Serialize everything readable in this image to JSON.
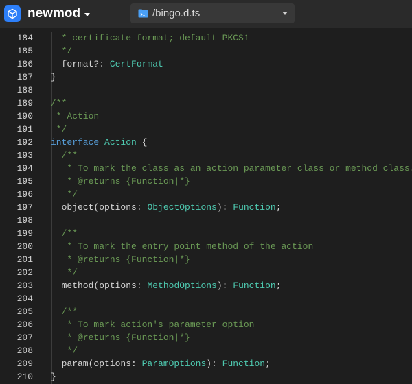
{
  "app": {
    "project_name": "newmod",
    "file_path": "/bingo.d.ts",
    "logo_icon": "cube-icon",
    "accent": "#2d7ff9"
  },
  "editor": {
    "lines": [
      {
        "no": "184",
        "segments": [
          {
            "t": "  * certificate format; default PKCS1",
            "c": "c"
          }
        ]
      },
      {
        "no": "185",
        "segments": [
          {
            "t": "  */",
            "c": "c"
          }
        ]
      },
      {
        "no": "186",
        "segments": [
          {
            "t": "  format?: ",
            "c": "p"
          },
          {
            "t": "CertFormat",
            "c": "t"
          }
        ]
      },
      {
        "no": "187",
        "segments": [
          {
            "t": "}",
            "c": "p"
          }
        ]
      },
      {
        "no": "188",
        "segments": []
      },
      {
        "no": "189",
        "segments": [
          {
            "t": "/**",
            "c": "c"
          }
        ]
      },
      {
        "no": "190",
        "segments": [
          {
            "t": " * Action",
            "c": "c"
          }
        ]
      },
      {
        "no": "191",
        "segments": [
          {
            "t": " */",
            "c": "c"
          }
        ]
      },
      {
        "no": "192",
        "segments": [
          {
            "t": "interface ",
            "c": "k"
          },
          {
            "t": "Action",
            "c": "t"
          },
          {
            "t": " {",
            "c": "p"
          }
        ]
      },
      {
        "no": "193",
        "segments": [
          {
            "t": "  /**",
            "c": "c"
          }
        ]
      },
      {
        "no": "194",
        "segments": [
          {
            "t": "   * To mark the class as an action parameter class or method class.",
            "c": "c"
          }
        ]
      },
      {
        "no": "195",
        "segments": [
          {
            "t": "   * @returns {Function|*}",
            "c": "c"
          }
        ]
      },
      {
        "no": "196",
        "segments": [
          {
            "t": "   */",
            "c": "c"
          }
        ]
      },
      {
        "no": "197",
        "segments": [
          {
            "t": "  object(options: ",
            "c": "p"
          },
          {
            "t": "ObjectOptions",
            "c": "t"
          },
          {
            "t": "): ",
            "c": "p"
          },
          {
            "t": "Function",
            "c": "t"
          },
          {
            "t": ";",
            "c": "p"
          }
        ]
      },
      {
        "no": "198",
        "segments": []
      },
      {
        "no": "199",
        "segments": [
          {
            "t": "  /**",
            "c": "c"
          }
        ]
      },
      {
        "no": "200",
        "segments": [
          {
            "t": "   * To mark the entry point method of the action",
            "c": "c"
          }
        ]
      },
      {
        "no": "201",
        "segments": [
          {
            "t": "   * @returns {Function|*}",
            "c": "c"
          }
        ]
      },
      {
        "no": "202",
        "segments": [
          {
            "t": "   */",
            "c": "c"
          }
        ]
      },
      {
        "no": "203",
        "segments": [
          {
            "t": "  method(options: ",
            "c": "p"
          },
          {
            "t": "MethodOptions",
            "c": "t"
          },
          {
            "t": "): ",
            "c": "p"
          },
          {
            "t": "Function",
            "c": "t"
          },
          {
            "t": ";",
            "c": "p"
          }
        ]
      },
      {
        "no": "204",
        "segments": []
      },
      {
        "no": "205",
        "segments": [
          {
            "t": "  /**",
            "c": "c"
          }
        ]
      },
      {
        "no": "206",
        "segments": [
          {
            "t": "   * To mark action's parameter option",
            "c": "c"
          }
        ]
      },
      {
        "no": "207",
        "segments": [
          {
            "t": "   * @returns {Function|*}",
            "c": "c"
          }
        ]
      },
      {
        "no": "208",
        "segments": [
          {
            "t": "   */",
            "c": "c"
          }
        ]
      },
      {
        "no": "209",
        "segments": [
          {
            "t": "  param(options: ",
            "c": "p"
          },
          {
            "t": "ParamOptions",
            "c": "t"
          },
          {
            "t": "): ",
            "c": "p"
          },
          {
            "t": "Function",
            "c": "t"
          },
          {
            "t": ";",
            "c": "p"
          }
        ]
      },
      {
        "no": "210",
        "segments": [
          {
            "t": "}",
            "c": "p"
          }
        ]
      }
    ]
  }
}
